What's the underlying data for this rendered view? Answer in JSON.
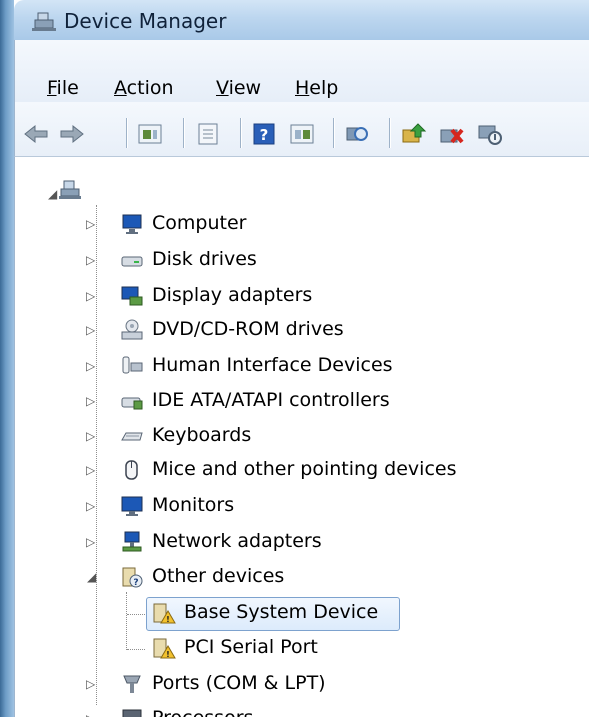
{
  "window": {
    "title": "Device Manager"
  },
  "menu": [
    {
      "prefix": "",
      "key": "F",
      "rest": "ile"
    },
    {
      "prefix": "",
      "key": "A",
      "rest": "ction"
    },
    {
      "prefix": "",
      "key": "V",
      "rest": "iew"
    },
    {
      "prefix": "",
      "key": "H",
      "rest": "elp"
    }
  ],
  "toolbar": [
    "back-icon",
    "forward-icon",
    "properties-pane-icon",
    "properties-icon",
    "help-icon",
    "show-hidden-icon",
    "scan-hardware-icon",
    "update-driver-icon",
    "uninstall-icon",
    "disable-icon"
  ],
  "tree": {
    "root_icon": "computer-network-icon",
    "items": [
      {
        "label": "Computer",
        "icon": "computer-icon"
      },
      {
        "label": "Disk drives",
        "icon": "disk-drive-icon"
      },
      {
        "label": "Display adapters",
        "icon": "display-adapter-icon"
      },
      {
        "label": "DVD/CD-ROM drives",
        "icon": "dvd-drive-icon"
      },
      {
        "label": "Human Interface Devices",
        "icon": "hid-icon"
      },
      {
        "label": "IDE ATA/ATAPI controllers",
        "icon": "ide-controller-icon"
      },
      {
        "label": "Keyboards",
        "icon": "keyboard-icon"
      },
      {
        "label": "Mice and other pointing devices",
        "icon": "mouse-icon"
      },
      {
        "label": "Monitors",
        "icon": "monitor-icon"
      },
      {
        "label": "Network adapters",
        "icon": "network-adapter-icon"
      },
      {
        "label": "Other devices",
        "icon": "unknown-device-icon",
        "expanded": true
      },
      {
        "label": "Base System Device",
        "icon": "warning-device-icon",
        "selected": true,
        "child": true
      },
      {
        "label": "PCI Serial Port",
        "icon": "warning-device-icon",
        "child": true
      },
      {
        "label": "Ports (COM & LPT)",
        "icon": "port-icon"
      },
      {
        "label": "Processors",
        "icon": "processor-icon"
      }
    ]
  }
}
